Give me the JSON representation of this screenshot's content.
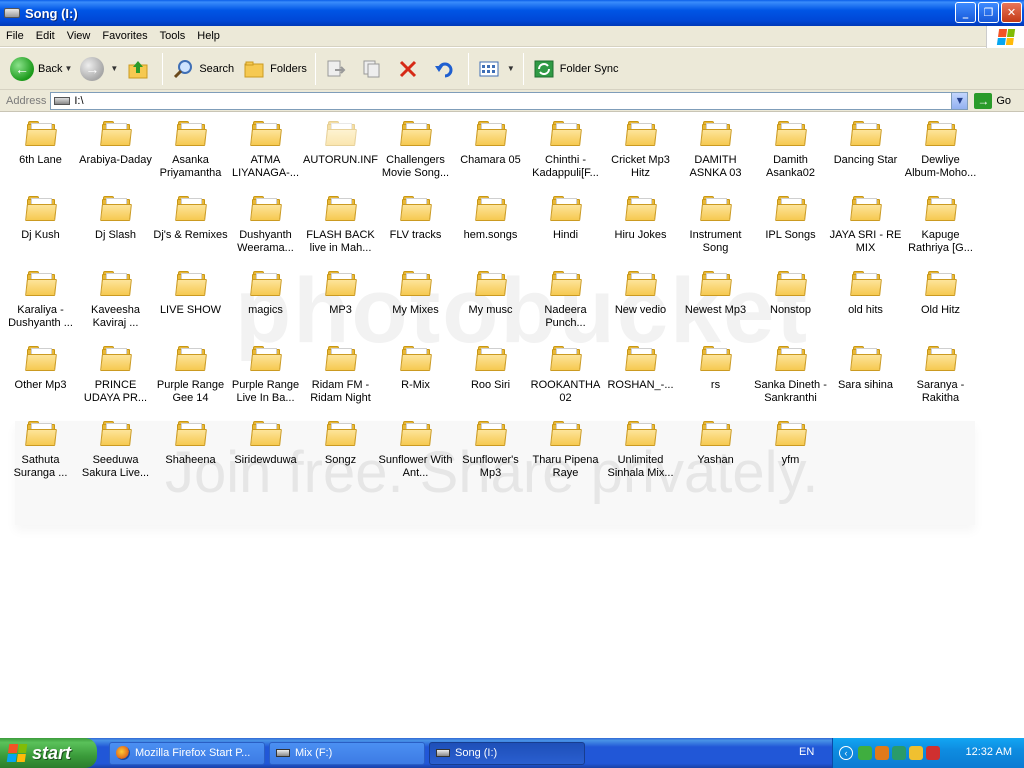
{
  "window": {
    "title": "Song (I:)"
  },
  "menu": [
    "File",
    "Edit",
    "View",
    "Favorites",
    "Tools",
    "Help"
  ],
  "toolbar": {
    "back_label": "Back",
    "search_label": "Search",
    "folders_label": "Folders",
    "folder_sync_label": "Folder Sync"
  },
  "address": {
    "label": "Address",
    "value": "I:\\",
    "go_label": "Go"
  },
  "files": [
    "6th Lane",
    "Arabiya-Daday",
    "Asanka Priyamantha",
    "ATMA LIYANAGA-...",
    "AUTORUN.INF",
    "Challengers Movie Song...",
    "Chamara 05",
    "Chinthi - Kadappuli[F...",
    "Cricket Mp3 Hitz",
    "DAMITH ASNKA  03",
    "Damith Asanka02",
    "Dancing  Star",
    "Dewliye Album-Moho...",
    "Dj Kush",
    "Dj Slash",
    "Dj's & Remixes",
    "Dushyanth Weerama...",
    "FLASH BACK live in Mah...",
    "FLV tracks",
    "hem.songs",
    "Hindi",
    "Hiru Jokes",
    "Instrument Song",
    "IPL Songs",
    "JAYA SRI - RE MIX",
    "Kapuge Rathriya [G...",
    "Karaliya - Dushyanth ...",
    "Kaveesha Kaviraj ...",
    "LIVE SHOW",
    "magics",
    "MP3",
    "My Mixes",
    "My musc",
    "Nadeera Punch...",
    "New vedio",
    "Newest Mp3",
    "Nonstop",
    "old hits",
    "Old Hitz",
    "Other Mp3",
    "PRINCE UDAYA PR...",
    "Purple Range Gee 14",
    "Purple Range Live In Ba...",
    "Ridam FM - Ridam Night",
    "R-Mix",
    "Roo Siri",
    "ROOKANTHA 02",
    "ROSHAN_-...",
    "rs",
    "Sanka Dineth - Sankranthi",
    "Sara sihina",
    "Saranya - Rakitha",
    "Sathuta Suranga ...",
    "Seeduwa Sakura Live...",
    "Shaheena",
    "Siridewduwa",
    "Songz",
    "Sunflower With Ant...",
    "Sunflower's Mp3",
    "Tharu Pipena Raye",
    "Unlimited Sinhala Mix...",
    "Yashan",
    "yfm"
  ],
  "faded_item": "AUTORUN.INF",
  "watermark": {
    "brand": "photobucket",
    "tagline": "Join free. Share privately."
  },
  "taskbar": {
    "start_label": "start",
    "tasks": [
      "Mozilla Firefox Start P...",
      "Mix (F:)",
      "Song (I:)"
    ],
    "language": "EN",
    "clock": "12:32 AM"
  }
}
